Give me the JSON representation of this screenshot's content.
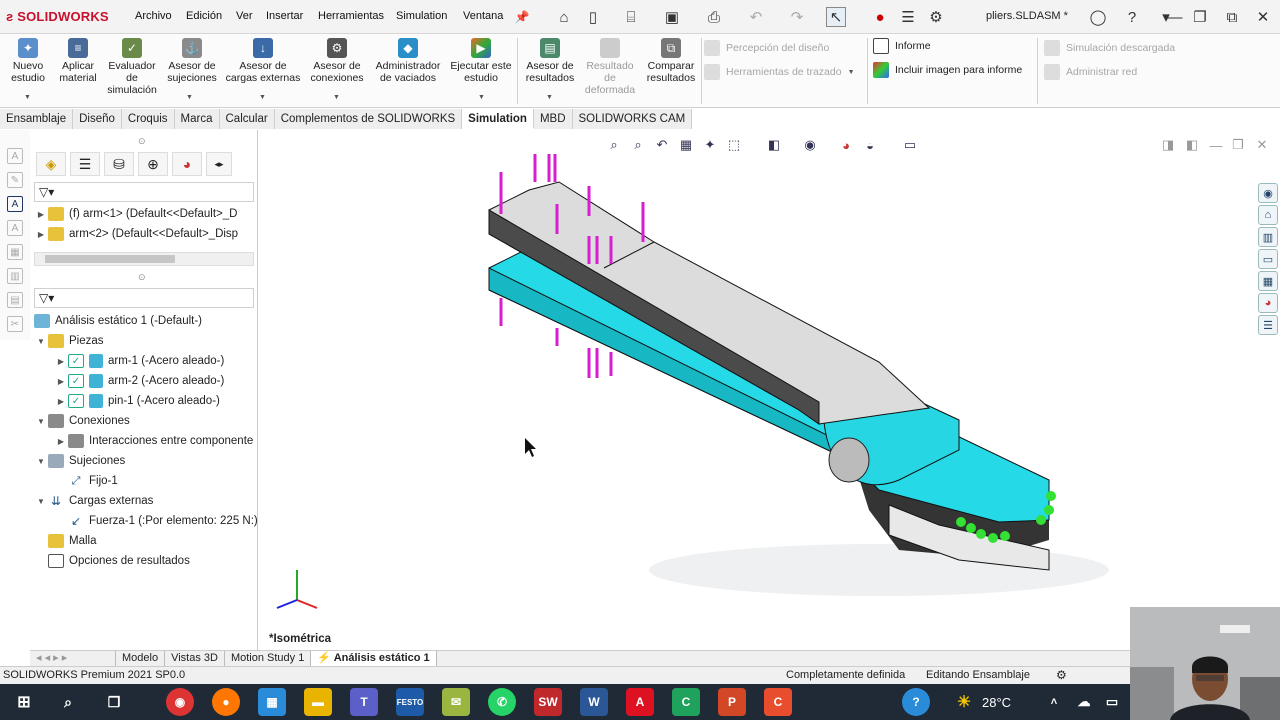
{
  "app": {
    "logo": "SOLIDWORKS",
    "doc_title": "pliers.SLDASM *"
  },
  "menu": [
    "Archivo",
    "Edición",
    "Ver",
    "Insertar",
    "Herramientas",
    "Simulation",
    "Ventana"
  ],
  "ribbon": {
    "buttons": [
      {
        "label": "Nuevo\nestudio",
        "icon": "new-study-icon"
      },
      {
        "label": "Aplicar\nmaterial",
        "icon": "apply-material-icon"
      },
      {
        "label": "Evaluador\nde\nsimulación",
        "icon": "simulation-evaluator-icon"
      },
      {
        "label": "Asesor de\nsujeciones",
        "icon": "fixtures-advisor-icon"
      },
      {
        "label": "Asesor de\ncargas externas",
        "icon": "external-loads-advisor-icon"
      },
      {
        "label": "Asesor de\nconexiones",
        "icon": "connections-advisor-icon"
      },
      {
        "label": "Administrador\nde vaciados",
        "icon": "shell-manager-icon"
      },
      {
        "label": "Ejecutar este\nestudio",
        "icon": "run-study-icon"
      },
      {
        "label": "Asesor de\nresultados",
        "icon": "results-advisor-icon"
      },
      {
        "label": "Resultado\nde\ndeformada",
        "icon": "deformed-result-icon"
      },
      {
        "label": "Comparar\nresultados",
        "icon": "compare-results-icon"
      }
    ],
    "small": {
      "design_insight": "Percepción del diseño",
      "plot_tools": "Herramientas de trazado",
      "report": "Informe",
      "include_image": "Incluir imagen para informe",
      "sim_downloaded": "Simulación descargada",
      "manage_network": "Administrar red"
    }
  },
  "tabs": [
    "Ensamblaje",
    "Diseño",
    "Croquis",
    "Marca",
    "Calcular",
    "Complementos de SOLIDWORKS",
    "Simulation",
    "MBD",
    "SOLIDWORKS CAM"
  ],
  "active_tab": "Simulation",
  "feature_tree": {
    "items": [
      "(f) arm<1> (Default<<Default>_D",
      "arm<2> (Default<<Default>_Disp"
    ]
  },
  "study_tree": {
    "root": "Análisis estático 1 (-Default-)",
    "parts_label": "Piezas",
    "parts": [
      "arm-1 (-Acero aleado-)",
      "arm-2 (-Acero aleado-)",
      "pin-1 (-Acero aleado-)"
    ],
    "connections_label": "Conexiones",
    "connections_child": "Interacciones entre componente",
    "fixtures_label": "Sujeciones",
    "fixtures_child": "Fijo-1",
    "loads_label": "Cargas externas",
    "loads_child": "Fuerza-1 (:Por elemento: 225 N:)",
    "mesh_label": "Malla",
    "results_options": "Opciones de resultados"
  },
  "viewport": {
    "view_label": "*Isométrica"
  },
  "bottom_tabs": [
    "Modelo",
    "Vistas 3D",
    "Motion Study 1",
    "Análisis estático 1"
  ],
  "status": {
    "product": "SOLIDWORKS Premium 2021 SP0.0",
    "defined": "Completamente definida",
    "editing": "Editando Ensamblaje"
  },
  "taskbar": {
    "temperature": "28°C"
  }
}
